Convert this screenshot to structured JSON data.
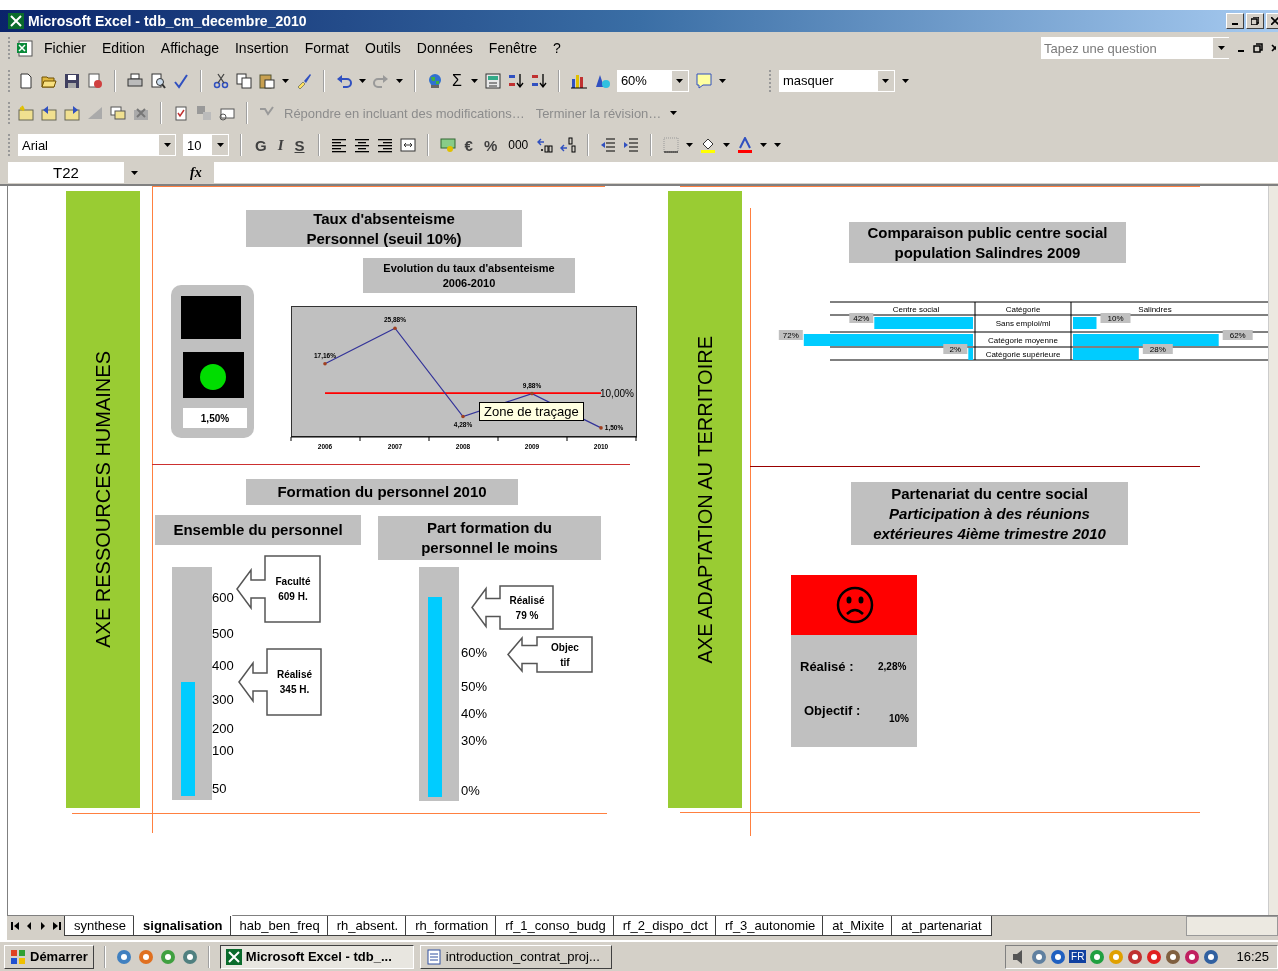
{
  "window": {
    "title": "Microsoft Excel - tdb_cm_decembre_2010"
  },
  "menu": [
    "Fichier",
    "Edition",
    "Affichage",
    "Insertion",
    "Format",
    "Outils",
    "Données",
    "Fenêtre",
    "?"
  ],
  "question": {
    "placeholder": "Tapez une question"
  },
  "standard_toolbar": {
    "sum": "Σ",
    "zoom": "60%",
    "style": "masquer"
  },
  "review_toolbar": {
    "reply": "Répondre en incluant des modifications…",
    "end_review": "Terminer la révision…",
    "disabled": true
  },
  "format_toolbar": {
    "font": "Arial",
    "size": "10",
    "bold": "G",
    "italic": "I",
    "underline": "S",
    "euro": "€",
    "percent": "%",
    "thousands": "000"
  },
  "formula_bar": {
    "cell": "T22",
    "function": "fx"
  },
  "sheet": {
    "axes": [
      {
        "label": "AXE RESSOURCES HUMAINES"
      },
      {
        "label": "AXE ADAPTATION AU TERRITOIRE"
      }
    ],
    "absenteeism": {
      "title": "Taux d'absenteisme\nPersonnel (seuil 10%)",
      "gauge": {
        "light": {
          "color": "#00dd00"
        },
        "reading": "1,50%"
      },
      "chart_title": "Evolution du taux d'absenteisme\n2006-2010",
      "chart_data": {
        "type": "line",
        "categories": [
          "2006",
          "2007",
          "2008",
          "2009",
          "2010"
        ],
        "series": [
          {
            "color": "#333399",
            "values": [
              17.16,
              25.88,
              4.28,
              9.88,
              1.5
            ],
            "value_labels": [
              "17,16%",
              "25,88%",
              "4,28%",
              "9,88%",
              "1,50%"
            ]
          },
          {
            "color": "#ff0000",
            "values": [
              10,
              10,
              10,
              10,
              10
            ],
            "value_labels": [
              null,
              null,
              null,
              null,
              "10,00%"
            ]
          }
        ]
      },
      "tooltip": "Zone de traçage"
    },
    "training": {
      "title": "Formation du personnel 2010",
      "panels": [
        {
          "title": "Ensemble du personnel",
          "level": 0.5,
          "ticks": [
            "600",
            "500",
            "400",
            "300",
            "200",
            "100",
            "50"
          ],
          "callouts": [
            "Faculté\n609 H.",
            "Réalisé\n345 H."
          ]
        },
        {
          "title": "Part formation du\npersonnel le moins",
          "level": 0.87,
          "ticks": [
            "60%",
            "50%",
            "40%",
            "30%",
            "0%"
          ],
          "callouts": [
            "Réalisé\n79 %",
            "Objec\ntif"
          ]
        }
      ]
    },
    "comparison": {
      "title": "Comparaison public centre social\npopulation Salindres 2009",
      "category_header": "Catégorie",
      "centre_social": {
        "chart_data": {
          "type": "bar",
          "orientation": "horizontal",
          "title": "Centre social",
          "categories": [
            "Sans emploi/ml",
            "Catégorie moyenne",
            "Catégorie supérieure"
          ],
          "series": [
            {
              "color": "#00ccff",
              "values": [
                42,
                72,
                2
              ],
              "value_labels": [
                "42%",
                "72%",
                "2%"
              ]
            }
          ]
        }
      },
      "salindres": {
        "chart_data": {
          "type": "bar",
          "orientation": "horizontal",
          "title": "Salindres",
          "series": [
            {
              "color": "#00ccff",
              "values": [
                10,
                62,
                28
              ],
              "value_labels": [
                "10%",
                "62%",
                "28%"
              ]
            }
          ]
        }
      }
    },
    "partnership": {
      "title": "Partenariat du centre social",
      "subtitle": "Participation à des réunions\nextérieures 4ième trimestre 2010",
      "status": {
        "color": "#ff0000"
      },
      "realised_label": "Réalisé :",
      "realised": "2,28%",
      "target_label": "Objectif :",
      "target": "10%"
    }
  },
  "sheet_tabs": [
    {
      "label": "synthese",
      "selected": false
    },
    {
      "label": "signalisation",
      "selected": true
    },
    {
      "label": "hab_ben_freq",
      "selected": false
    },
    {
      "label": "rh_absent.",
      "selected": false
    },
    {
      "label": "rh_formation",
      "selected": false
    },
    {
      "label": "rf_1_conso_budg",
      "selected": false
    },
    {
      "label": "rf_2_dispo_dct",
      "selected": false
    },
    {
      "label": "rf_3_autonomie",
      "selected": false
    },
    {
      "label": "at_Mixite",
      "selected": false
    },
    {
      "label": "at_partenariat",
      "selected": false
    }
  ],
  "taskbar": {
    "start": "Démarrer",
    "tasks": [
      {
        "label": "Microsoft Excel - tdb_...",
        "selected": true
      },
      {
        "label": "introduction_contrat_proj...",
        "selected": false
      }
    ],
    "language": "FR",
    "time": "16:25"
  }
}
